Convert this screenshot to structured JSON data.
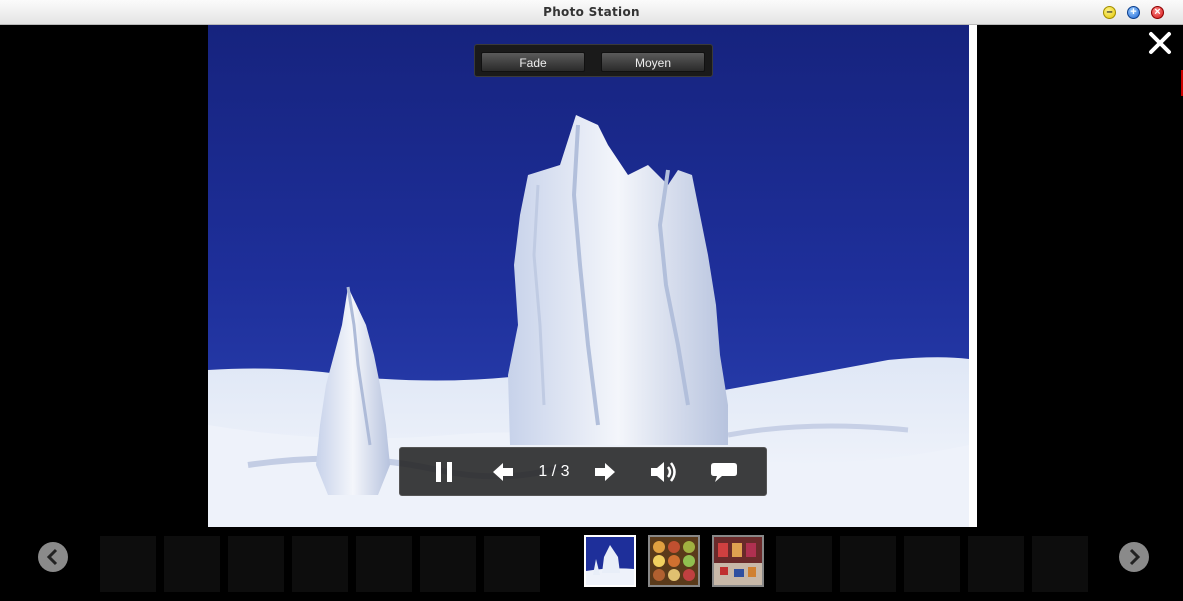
{
  "window": {
    "title": "Photo Station"
  },
  "effects": {
    "transition": "Fade",
    "speed": "Moyen"
  },
  "slideshow": {
    "counter": "1 / 3"
  },
  "icons": {
    "close": "close-icon",
    "pause": "pause-icon",
    "previous": "arrow-left-icon",
    "next": "arrow-right-icon",
    "volume": "speaker-icon",
    "comments": "speech-bubble-icon",
    "strip_prev": "chevron-left-icon",
    "strip_next": "chevron-right-icon"
  },
  "thumbnails": [
    {
      "name": "snowy-trees",
      "active": true
    },
    {
      "name": "colorful-dishes",
      "active": false
    },
    {
      "name": "market-stall",
      "active": false
    }
  ]
}
